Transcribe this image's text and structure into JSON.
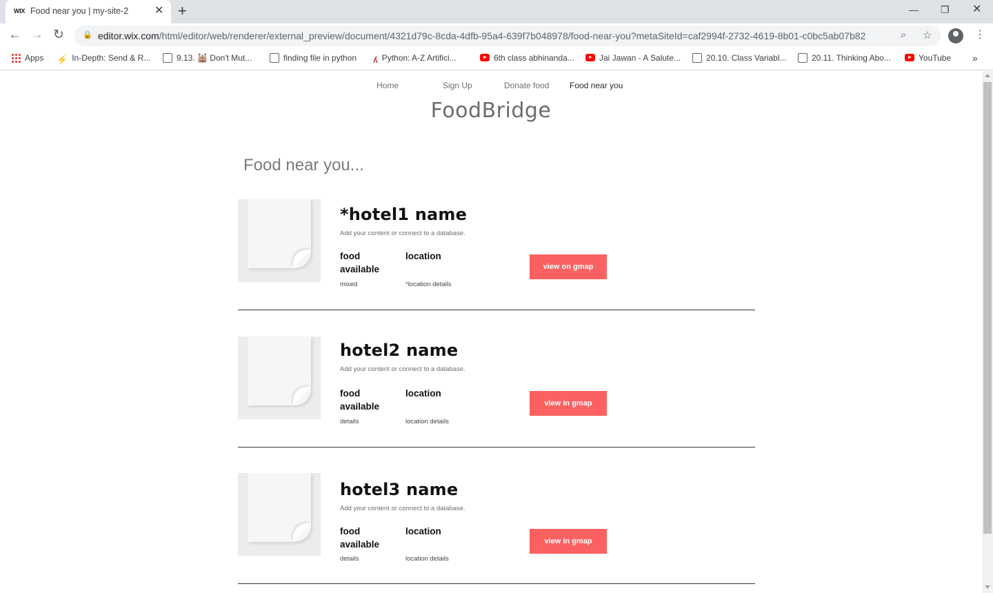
{
  "browser": {
    "tab_favicon": "WIX",
    "tab_title": "Food near you | my-site-2",
    "url_host": "editor.wix.com",
    "url_path": "/html/editor/web/renderer/external_preview/document/4321d79c-8cda-4dfb-95a4-639f7b048978/food-near-you?metaSiteId=caf2994f-2732-4619-8b01-c0bc5ab07b82",
    "bookmarks": [
      {
        "label": "Apps",
        "icon": "apps-grid-icon"
      },
      {
        "label": "In-Depth: Send & R...",
        "icon": "bolt-icon"
      },
      {
        "label": "9.13. 🕍 Don't Mut...",
        "icon": "doc-icon"
      },
      {
        "label": "finding file in python",
        "icon": "doc-icon"
      },
      {
        "label": "Python: A-Z Artifici...",
        "icon": "python-course-icon"
      },
      {
        "label": "6th class abhinanda...",
        "icon": "youtube-icon"
      },
      {
        "label": "Jai Jawan - A Salute...",
        "icon": "youtube-icon"
      },
      {
        "label": "20.10. Class Variabl...",
        "icon": "doc-icon"
      },
      {
        "label": "20.11. Thinking Abo...",
        "icon": "doc-icon"
      },
      {
        "label": "YouTube",
        "icon": "youtube-icon"
      }
    ]
  },
  "site": {
    "nav": [
      "Home",
      "Sign Up",
      "Donate food",
      "Food near you"
    ],
    "active_nav": "Food near you",
    "brand": "FoodBridge",
    "heading": "Food near you..."
  },
  "hotels": [
    {
      "name": "*hotel1 name",
      "description": "Add your content or connect to a database.",
      "food_label": "food available",
      "location_label": "location",
      "food_value": "mixed",
      "location_value": "*location details",
      "button": "view on gmap"
    },
    {
      "name": "hotel2 name",
      "description": "Add your content or connect to a database.",
      "food_label": "food available",
      "location_label": "location",
      "food_value": "details",
      "location_value": "location details",
      "button": "view in gmap"
    },
    {
      "name": "hotel3 name",
      "description": "Add your content or connect to a database.",
      "food_label": "food available",
      "location_label": "location",
      "food_value": "details",
      "location_value": "location details",
      "button": "view in gmap"
    }
  ],
  "colors": {
    "button": "#fb6161",
    "brand_text": "#6b6b6b"
  }
}
